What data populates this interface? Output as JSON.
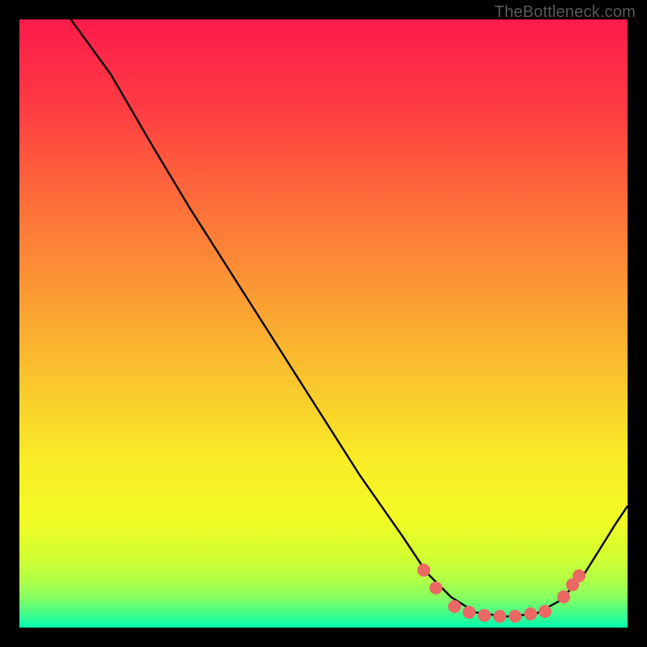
{
  "watermark": "TheBottleneck.com",
  "chart_data": {
    "type": "line",
    "title": "",
    "xlabel": "",
    "ylabel": "",
    "xlim": [
      0,
      100
    ],
    "ylim": [
      0,
      100
    ],
    "curve_points": [
      {
        "x": 7,
        "y": 102
      },
      {
        "x": 15,
        "y": 91
      },
      {
        "x": 22,
        "y": 79
      },
      {
        "x": 28,
        "y": 69
      },
      {
        "x": 35,
        "y": 58
      },
      {
        "x": 42,
        "y": 47
      },
      {
        "x": 49,
        "y": 36
      },
      {
        "x": 56,
        "y": 25
      },
      {
        "x": 63,
        "y": 15
      },
      {
        "x": 67,
        "y": 9
      },
      {
        "x": 71,
        "y": 5
      },
      {
        "x": 75,
        "y": 2.5
      },
      {
        "x": 80,
        "y": 1.8
      },
      {
        "x": 85,
        "y": 2.3
      },
      {
        "x": 89,
        "y": 4.5
      },
      {
        "x": 93,
        "y": 9
      },
      {
        "x": 98,
        "y": 17
      },
      {
        "x": 100,
        "y": 20
      }
    ],
    "scatter_points": [
      {
        "x": 66.5,
        "y": 9.5
      },
      {
        "x": 68.5,
        "y": 6.5
      },
      {
        "x": 71.5,
        "y": 3.5
      },
      {
        "x": 74,
        "y": 2.5
      },
      {
        "x": 76.5,
        "y": 2
      },
      {
        "x": 79,
        "y": 1.8
      },
      {
        "x": 81.5,
        "y": 1.8
      },
      {
        "x": 84,
        "y": 2.2
      },
      {
        "x": 86.5,
        "y": 2.6
      },
      {
        "x": 89.5,
        "y": 5
      },
      {
        "x": 91,
        "y": 7
      },
      {
        "x": 92,
        "y": 8.5
      }
    ],
    "gradient_stops": [
      {
        "offset": 0,
        "color": "#fd1b4b"
      },
      {
        "offset": 15,
        "color": "#fe3d42"
      },
      {
        "offset": 30,
        "color": "#fd6d3a"
      },
      {
        "offset": 45,
        "color": "#fb9a33"
      },
      {
        "offset": 60,
        "color": "#f9c72c"
      },
      {
        "offset": 72,
        "color": "#f9eb27"
      },
      {
        "offset": 82,
        "color": "#f2fa24"
      },
      {
        "offset": 88,
        "color": "#d4fe30"
      },
      {
        "offset": 92,
        "color": "#b3ff45"
      },
      {
        "offset": 95,
        "color": "#86ff60"
      },
      {
        "offset": 97,
        "color": "#55fd7f"
      },
      {
        "offset": 99,
        "color": "#1ffba0"
      },
      {
        "offset": 100,
        "color": "#09fbac"
      }
    ]
  }
}
